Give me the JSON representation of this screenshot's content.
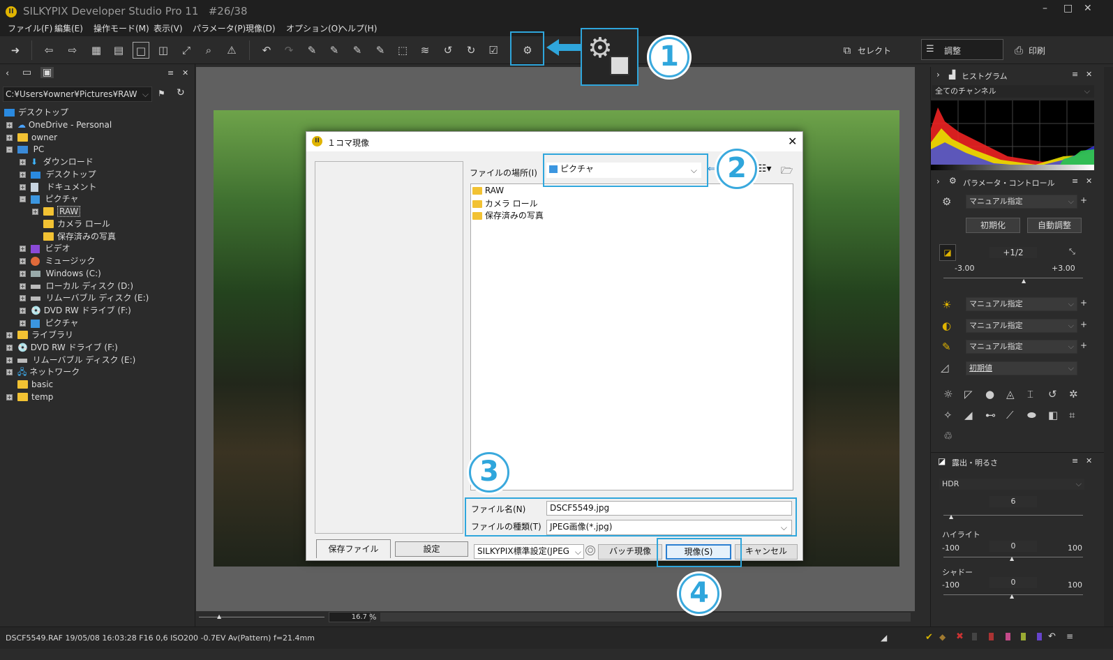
{
  "title": {
    "app": "SILKYPIX Developer Studio Pro 11",
    "counter": "#26/38"
  },
  "menu": [
    "ファイル(F)",
    "編集(E)",
    "操作モード(M)",
    "表示(V)",
    "パラメータ(P)",
    "現像(D)",
    "オプション(O)",
    "ヘルプ(H)"
  ],
  "toolbar": {
    "select_label": "セレクト",
    "adjust_label": "調整",
    "print_label": "印刷"
  },
  "left": {
    "path": "C:¥Users¥owner¥Pictures¥RAW",
    "tree": [
      "デスクトップ",
      "OneDrive - Personal",
      "owner",
      "PC",
      "ダウンロード",
      "デスクトップ",
      "ドキュメント",
      "ピクチャ",
      "RAW",
      "カメラ ロール",
      "保存済みの写真",
      "ビデオ",
      "ミュージック",
      "Windows (C:)",
      "ローカル ディスク (D:)",
      "リムーバブル ディスク (E:)",
      "DVD RW ドライブ (F:)",
      "ピクチャ",
      "ライブラリ",
      "DVD RW ドライブ (F:)",
      "リムーバブル ディスク (E:)",
      "ネットワーク",
      "basic",
      "temp"
    ]
  },
  "zoom": "16.7",
  "zoom_unit": "%",
  "right": {
    "histogram_title": "ヒストグラム",
    "channel": "全てのチャンネル",
    "param_title": "パラメータ・コントロール",
    "manual": "マニュアル指定",
    "init_btn": "初期化",
    "auto_btn": "自動調整",
    "exp_value": "+1/2",
    "exp_min": "-3.00",
    "exp_max": "+3.00",
    "wb": "マニュアル指定",
    "tone": "マニュアル指定",
    "color": "マニュアル指定",
    "sharp": "初期値",
    "exposure_title": "露出・明るさ",
    "hdr_label": "HDR",
    "hdr_value": "6",
    "highlight_label": "ハイライト",
    "highlight_min": "-100",
    "highlight_value": "0",
    "highlight_max": "100",
    "shadow_label": "シャドー",
    "shadow_min": "-100",
    "shadow_value": "0",
    "shadow_max": "100"
  },
  "status": "DSCF5549.RAF 19/05/08 16:03:28 F16 0,6 ISO200 -0.7EV Av(Pattern) f=21.4mm",
  "dialog": {
    "title": "１コマ現像",
    "location_label": "ファイルの場所(I)",
    "location_value": "ピクチャ",
    "files": [
      "RAW",
      "カメラ ロール",
      "保存済みの写真"
    ],
    "filename_label": "ファイル名(N)",
    "filename_value": "DSCF5549.jpg",
    "filetype_label": "ファイルの種類(T)",
    "filetype_value": "JPEG画像(*.jpg)",
    "tab_save": "保存ファイル",
    "tab_settings": "設定",
    "preset": "SILKYPIX標準設定(JPEG",
    "batch_btn": "バッチ現像",
    "develop_btn": "現像(S)",
    "cancel_btn": "キャンセル"
  },
  "callouts": [
    "1",
    "2",
    "3",
    "4"
  ],
  "colors": {
    "accent": "#2fa6dc",
    "folder": "#f2c233"
  }
}
